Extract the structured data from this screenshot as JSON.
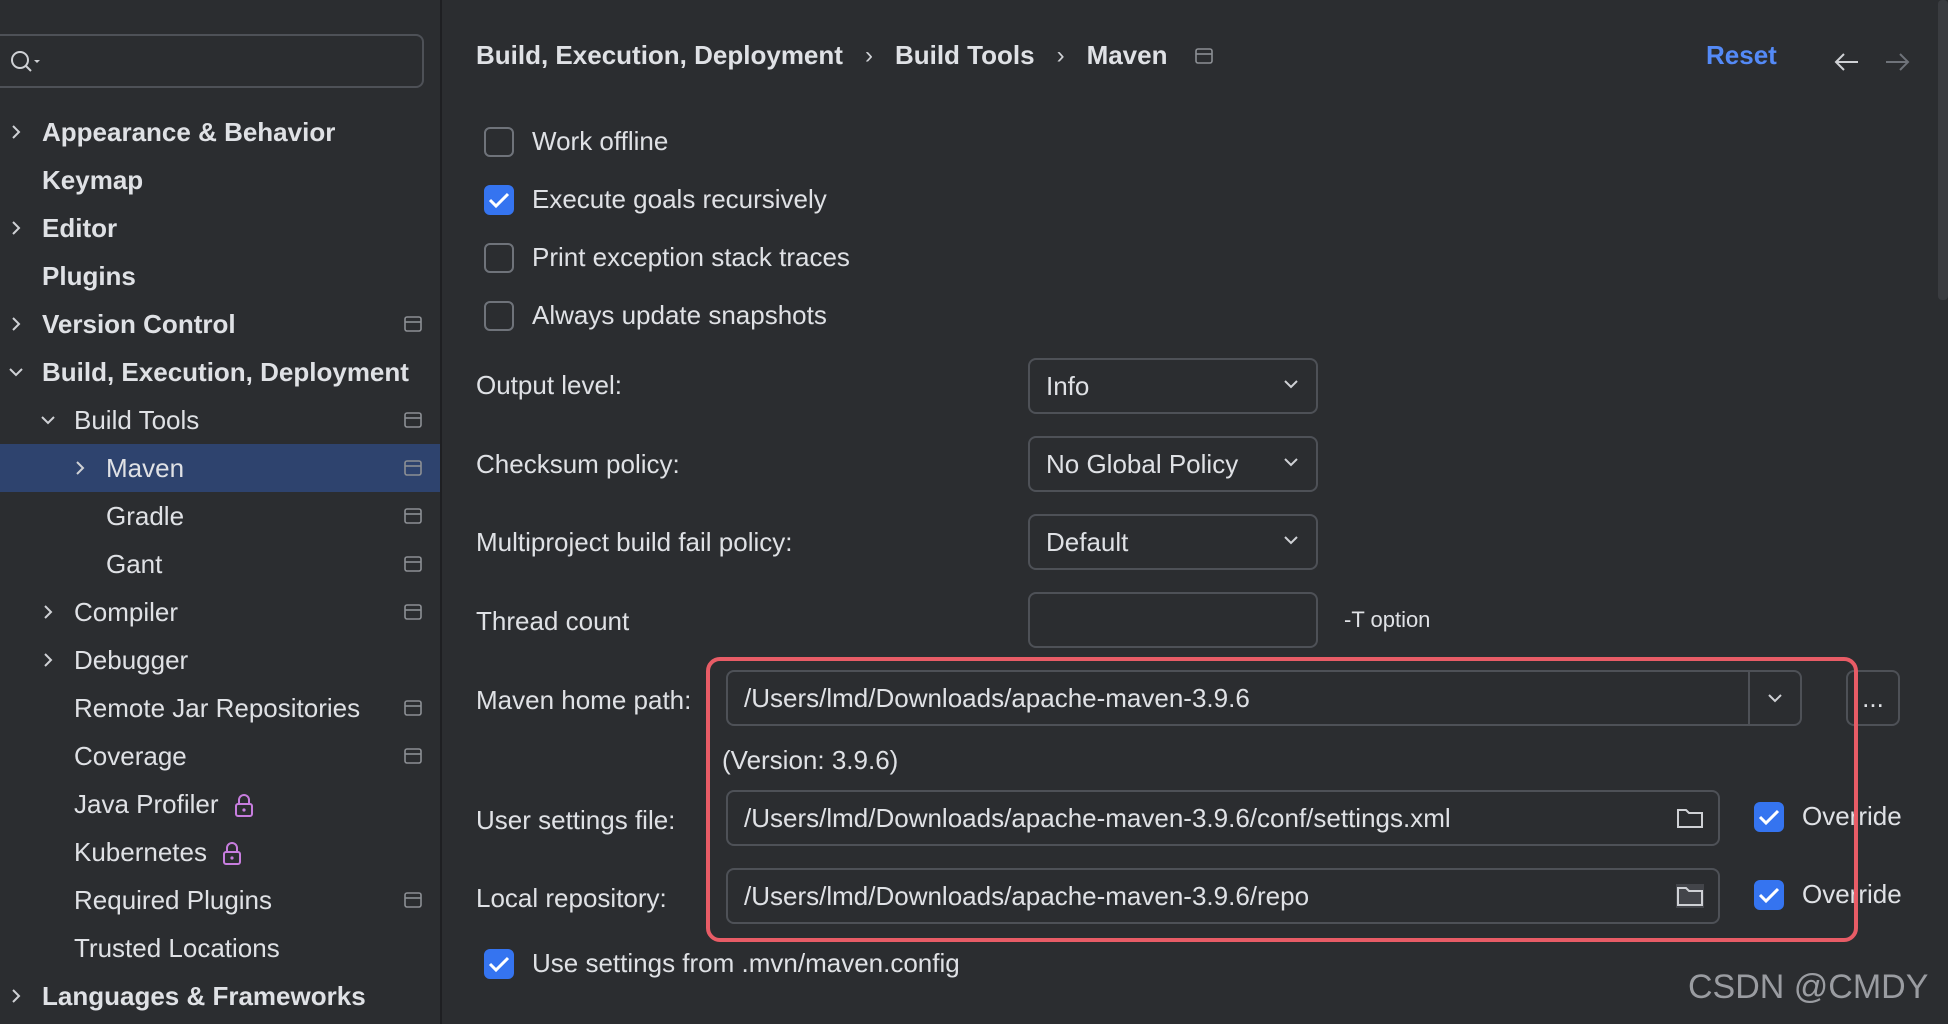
{
  "sidebar": {
    "search_placeholder": "",
    "items": [
      {
        "label": "Appearance & Behavior"
      },
      {
        "label": "Keymap"
      },
      {
        "label": "Editor"
      },
      {
        "label": "Plugins"
      },
      {
        "label": "Version Control"
      },
      {
        "label": "Build, Execution, Deployment"
      },
      {
        "label": "Build Tools"
      },
      {
        "label": "Maven"
      },
      {
        "label": "Gradle"
      },
      {
        "label": "Gant"
      },
      {
        "label": "Compiler"
      },
      {
        "label": "Debugger"
      },
      {
        "label": "Remote Jar Repositories"
      },
      {
        "label": "Coverage"
      },
      {
        "label": "Java Profiler"
      },
      {
        "label": "Kubernetes"
      },
      {
        "label": "Required Plugins"
      },
      {
        "label": "Trusted Locations"
      },
      {
        "label": "Languages & Frameworks"
      }
    ]
  },
  "header": {
    "breadcrumb": [
      "Build, Execution, Deployment",
      "Build Tools",
      "Maven"
    ],
    "separator": "›",
    "reset_label": "Reset"
  },
  "options": {
    "work_offline": {
      "label": "Work offline",
      "checked": false
    },
    "execute_goals": {
      "label": "Execute goals recursively",
      "checked": true
    },
    "print_exceptions": {
      "label": "Print exception stack traces",
      "checked": false
    },
    "always_update": {
      "label": "Always update snapshots",
      "checked": false
    }
  },
  "form": {
    "output_level": {
      "label": "Output level:",
      "value": "Info"
    },
    "checksum_policy": {
      "label": "Checksum policy:",
      "value": "No Global Policy"
    },
    "multiproject": {
      "label": "Multiproject build fail policy:",
      "value": "Default"
    },
    "thread_count": {
      "label": "Thread count",
      "value": "",
      "hint": "-T option"
    },
    "maven_home": {
      "label": "Maven home path:",
      "value": "/Users/lmd/Downloads/apache-maven-3.9.6",
      "browse_label": "...",
      "version": "(Version: 3.9.6)"
    },
    "user_settings": {
      "label": "User settings file:",
      "value": "/Users/lmd/Downloads/apache-maven-3.9.6/conf/settings.xml",
      "override_label": "Override",
      "override_checked": true
    },
    "local_repo": {
      "label": "Local repository:",
      "value": "/Users/lmd/Downloads/apache-maven-3.9.6/repo",
      "override_label": "Override",
      "override_checked": true
    },
    "use_mvn_config": {
      "label": "Use settings from .mvn/maven.config",
      "checked": true
    }
  },
  "watermark": "CSDN @CMDY",
  "colors": {
    "accent": "#3574f0",
    "link": "#548af7",
    "highlight": "#e85c66",
    "selection": "#2e436e"
  }
}
